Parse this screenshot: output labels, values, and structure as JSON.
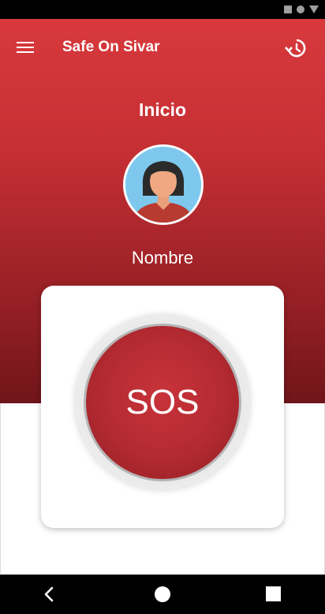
{
  "status_bar": {
    "icons": [
      "square-icon",
      "circle-icon",
      "signal-icon"
    ]
  },
  "app_bar": {
    "title": "Safe On Sivar",
    "menu_icon": "menu-icon",
    "history_icon": "history-icon"
  },
  "home": {
    "title": "Inicio",
    "user_name": "Nombre",
    "avatar_icon": "avatar-icon"
  },
  "sos": {
    "label": "SOS"
  },
  "nav_bar": {
    "back_icon": "back-icon",
    "home_icon": "home-icon",
    "recents_icon": "recents-icon"
  },
  "colors": {
    "primary": "#d8393c",
    "primary_dark": "#6f1519",
    "sos_red": "#b42a31",
    "avatar_bg": "#7ec8ee"
  }
}
